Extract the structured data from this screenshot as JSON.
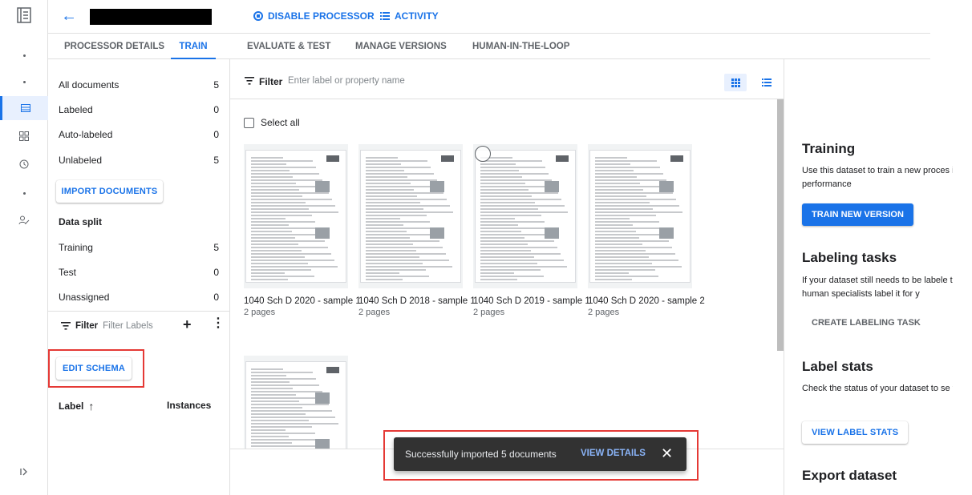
{
  "header": {
    "disable_processor": "DISABLE PROCESSOR",
    "activity": "ACTIVITY"
  },
  "tabs": [
    {
      "label": "PROCESSOR DETAILS"
    },
    {
      "label": "TRAIN"
    },
    {
      "label": "EVALUATE & TEST"
    },
    {
      "label": "MANAGE VERSIONS"
    },
    {
      "label": "HUMAN-IN-THE-LOOP"
    }
  ],
  "left": {
    "filters": [
      {
        "label": "All documents",
        "count": "5"
      },
      {
        "label": "Labeled",
        "count": "0"
      },
      {
        "label": "Auto-labeled",
        "count": "0"
      },
      {
        "label": "Unlabeled",
        "count": "5"
      }
    ],
    "import_button": "IMPORT DOCUMENTS",
    "data_split_title": "Data split",
    "split": [
      {
        "label": "Training",
        "count": "5"
      },
      {
        "label": "Test",
        "count": "0"
      },
      {
        "label": "Unassigned",
        "count": "0"
      }
    ],
    "filter_label": "Filter",
    "filter_placeholder": "Filter Labels",
    "edit_schema": "EDIT SCHEMA",
    "col_label": "Label",
    "col_instances": "Instances"
  },
  "center": {
    "filter_label": "Filter",
    "search_placeholder": "Enter label or property name",
    "select_all": "Select all",
    "documents": [
      {
        "name": "1040 Sch D 2020 - sample 1",
        "pages": "2 pages"
      },
      {
        "name": "1040 Sch D 2018 - sample 1",
        "pages": "2 pages"
      },
      {
        "name": "1040 Sch D 2019 - sample 1",
        "pages": "2 pages"
      },
      {
        "name": "1040 Sch D 2020 - sample 2",
        "pages": "2 pages"
      },
      {
        "name": "",
        "pages": ""
      }
    ]
  },
  "snackbar": {
    "message": "Successfully imported 5 documents",
    "action": "VIEW DETAILS"
  },
  "right": {
    "training_title": "Training",
    "training_text": "Use this dataset to train a new proces improved performance",
    "train_button": "TRAIN NEW VERSION",
    "labeling_title": "Labeling tasks",
    "labeling_text": "If your dataset still needs to be labele to have human specialists label it for y",
    "labeling_button": "CREATE LABELING TASK",
    "stats_title": "Label stats",
    "stats_text": "Check the status of your dataset to se training",
    "stats_button": "VIEW LABEL STATS",
    "export_title": "Export dataset"
  },
  "colors": {
    "accent": "#1a73e8",
    "highlight_box": "#e53935",
    "snackbar_bg": "#323232"
  }
}
